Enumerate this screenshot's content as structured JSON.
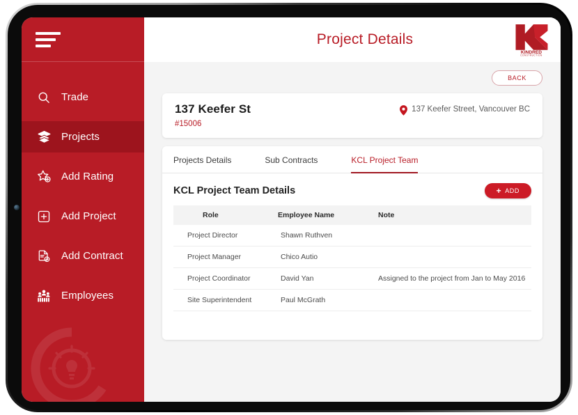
{
  "sidebar": {
    "menu_icon": "hamburger-menu-icon",
    "watermark_icon": "lightbulb-circle-watermark",
    "items": [
      {
        "label": "Trade",
        "icon": "search-icon",
        "active": false
      },
      {
        "label": "Projects",
        "icon": "layers-icon",
        "active": true
      },
      {
        "label": "Add Rating",
        "icon": "star-plus-icon",
        "active": false
      },
      {
        "label": "Add Project",
        "icon": "square-plus-icon",
        "active": false
      },
      {
        "label": "Add Contract",
        "icon": "document-plus-icon",
        "active": false
      },
      {
        "label": "Employees",
        "icon": "people-group-icon",
        "active": false
      }
    ]
  },
  "header": {
    "title": "Project Details",
    "logo_mark": "KC",
    "logo_name": "KINDRED",
    "logo_sub": "CONSTRUCTION"
  },
  "toolbar": {
    "back_label": "BACK"
  },
  "project": {
    "name": "137 Keefer St",
    "code": "#15006",
    "address": "137 Keefer Street, Vancouver BC",
    "pin_icon": "location-pin-icon"
  },
  "tabs": [
    {
      "label": "Projects Details",
      "active": false
    },
    {
      "label": "Sub Contracts",
      "active": false
    },
    {
      "label": "KCL Project Team",
      "active": true
    }
  ],
  "section": {
    "title": "KCL Project Team Details",
    "add_label": "ADD",
    "add_plus": "+"
  },
  "table": {
    "columns": [
      "Role",
      "Employee Name",
      "Note"
    ],
    "rows": [
      {
        "role": "Project Director",
        "name": "Shawn Ruthven",
        "note": ""
      },
      {
        "role": "Project Manager",
        "name": "Chico Autio",
        "note": ""
      },
      {
        "role": "Project Coordinator",
        "name": "David Yan",
        "note": "Assigned to the project from Jan to May 2016"
      },
      {
        "role": "Site Superintendent",
        "name": "Paul McGrath",
        "note": ""
      }
    ]
  },
  "colors": {
    "brand_red": "#b81c26",
    "active_red": "#9d141d",
    "button_red": "#cc1b26",
    "page_bg": "#f4f4f4"
  }
}
